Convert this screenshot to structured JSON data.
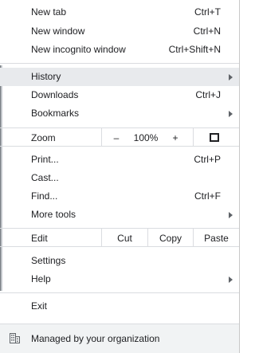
{
  "menu": {
    "new_tab": {
      "label": "New tab",
      "shortcut": "Ctrl+T"
    },
    "new_window": {
      "label": "New window",
      "shortcut": "Ctrl+N"
    },
    "new_incognito": {
      "label": "New incognito window",
      "shortcut": "Ctrl+Shift+N"
    },
    "history": {
      "label": "History"
    },
    "downloads": {
      "label": "Downloads",
      "shortcut": "Ctrl+J"
    },
    "bookmarks": {
      "label": "Bookmarks"
    },
    "zoom": {
      "label": "Zoom",
      "minus": "–",
      "value": "100%",
      "plus": "+"
    },
    "print": {
      "label": "Print...",
      "shortcut": "Ctrl+P"
    },
    "cast": {
      "label": "Cast..."
    },
    "find": {
      "label": "Find...",
      "shortcut": "Ctrl+F"
    },
    "more_tools": {
      "label": "More tools"
    },
    "edit": {
      "label": "Edit",
      "cut": "Cut",
      "copy": "Copy",
      "paste": "Paste"
    },
    "settings": {
      "label": "Settings"
    },
    "help": {
      "label": "Help"
    },
    "exit": {
      "label": "Exit"
    },
    "managed": {
      "label": "Managed by your organization"
    }
  },
  "icons": {
    "fullscreen": "fullscreen-icon",
    "submenu": "chevron-right-icon",
    "managed": "building-icon"
  },
  "colors": {
    "highlight": "#e8eaed",
    "separator": "#dadce0",
    "footer_bg": "#f1f3f4"
  }
}
